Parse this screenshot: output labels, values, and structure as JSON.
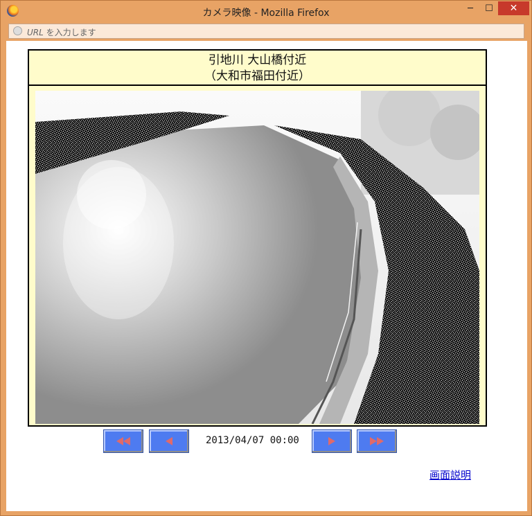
{
  "window": {
    "title": "カメラ映像 - Mozilla Firefox",
    "minimize": "─",
    "maximize": "☐",
    "close": "✕"
  },
  "urlbar": {
    "placeholder_prefix": "URL",
    "placeholder_suffix": " を入力します"
  },
  "camera": {
    "title_line1": "引地川 大山橋付近",
    "title_line2": "（大和市福田付近）",
    "image_description_icon": "river-camera-image"
  },
  "controls": {
    "datetime": "2013/04/07 00:00",
    "first_icon": "rewind-double-icon",
    "prev_icon": "prev-icon",
    "next_icon": "next-icon",
    "last_icon": "forward-double-icon"
  },
  "help_link": "画面説明",
  "colors": {
    "window_frame": "#e8a365",
    "close_button": "#c7392b",
    "caption_bg": "#fffccb",
    "nav_button": "#4e7bf0",
    "nav_arrow": "#e06a6a",
    "link": "#0000cc"
  }
}
